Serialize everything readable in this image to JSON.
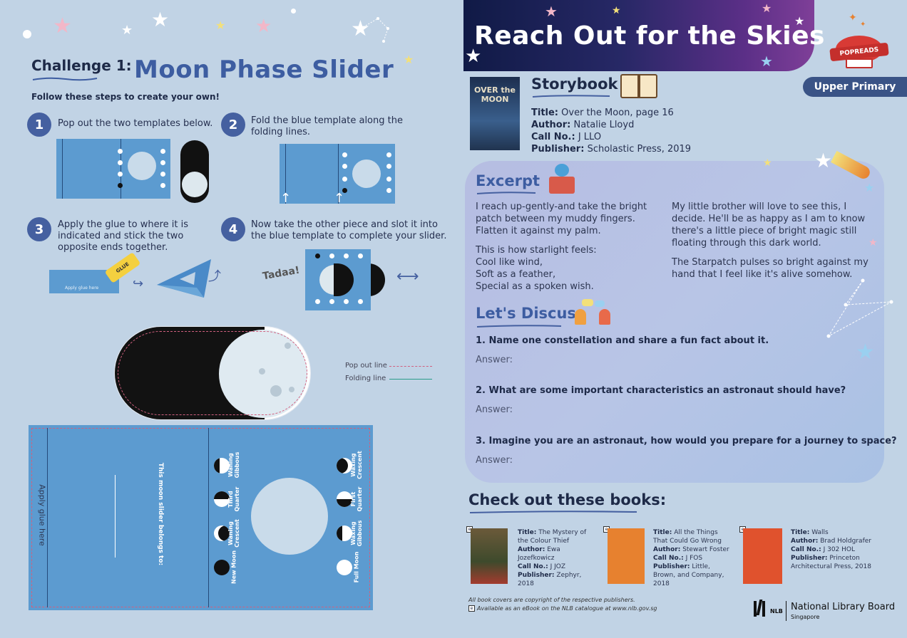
{
  "challenge": {
    "label": "Challenge 1:",
    "title": "Moon Phase Slider",
    "instructions": "Follow these steps to create your own!"
  },
  "steps": [
    {
      "num": "1",
      "text": "Pop out the two templates below."
    },
    {
      "num": "2",
      "text": "Fold the blue template along the folding lines."
    },
    {
      "num": "3",
      "text": "Apply the glue to where it is indicated and stick the two opposite ends together."
    },
    {
      "num": "4",
      "text": "Now take the other piece and slot it into the blue template to complete your slider."
    }
  ],
  "illustrations": {
    "glue_label": "GLUE",
    "apply_glue_small": "Apply glue here",
    "tadaa": "Tadaa!"
  },
  "legend": {
    "pop_out": "Pop out line",
    "folding": "Folding line"
  },
  "template": {
    "apply_glue": "Apply glue here",
    "belongs_to": "This moon slider belongs to:",
    "phases_left": [
      {
        "label": "Waning Gibbous"
      },
      {
        "label": "Third Quarter"
      },
      {
        "label": "Waning Crescent"
      },
      {
        "label": "New Moon"
      }
    ],
    "phases_right": [
      {
        "label": "Waxing Crescent"
      },
      {
        "label": "First Quarter"
      },
      {
        "label": "Waxing Gibbous"
      },
      {
        "label": "Full Moon"
      }
    ]
  },
  "header": {
    "title": "Reach Out for the Skies",
    "logo_text": "POPREADS",
    "level": "Upper Primary"
  },
  "storybook": {
    "heading": "Storybook",
    "cover_title": "OVER the MOON",
    "title_label": "Title:",
    "title": "Over the Moon, page 16",
    "author_label": "Author:",
    "author": "Natalie Lloyd",
    "call_label": "Call No.:",
    "call_no": "J LLO",
    "publisher_label": "Publisher:",
    "publisher": "Scholastic Press, 2019"
  },
  "excerpt": {
    "heading": "Excerpt",
    "left": [
      "I reach up-gently-and take the bright patch between my muddy fingers. Flatten it against my palm.",
      "This is how starlight feels:\nCool like wind,\nSoft as a feather,\nSpecial as a spoken wish."
    ],
    "right": [
      "My little brother will love to see this, I decide. He'll be as happy as I am to know there's a little piece of bright magic still floating through this dark world.",
      "The Starpatch pulses so bright against my hand that I feel like it's alive somehow."
    ]
  },
  "discuss": {
    "heading": "Let's Discuss",
    "answer_label": "Answer:",
    "questions": [
      "1. Name one constellation and share a fun fact about it.",
      "2. What are some important characteristics an astronaut should have?",
      "3. Imagine you are an astronaut, how would you prepare for a journey to space?"
    ]
  },
  "check_out": {
    "heading": "Check out these books:",
    "books": [
      {
        "title_label": "Title:",
        "title": "The Mystery of the Colour Thief",
        "author_label": "Author:",
        "author": "Ewa Jozefkowicz",
        "call_label": "Call No.:",
        "call_no": "J JOZ",
        "publisher_label": "Publisher:",
        "publisher": "Zephyr, 2018",
        "cover_color": "#6b5a3a"
      },
      {
        "title_label": "Title:",
        "title": "All the Things That Could Go Wrong",
        "author_label": "Author:",
        "author": "Stewart Foster",
        "call_label": "Call No.:",
        "call_no": "J FOS",
        "publisher_label": "Publisher:",
        "publisher": "Little, Brown, and Company, 2018",
        "cover_color": "#e7812f"
      },
      {
        "title_label": "Title:",
        "title": "Walls",
        "author_label": "Author:",
        "author": "Brad Holdgrafer",
        "call_label": "Call No.:",
        "call_no": "J 302 HOL",
        "publisher_label": "Publisher:",
        "publisher": "Princeton Architectural Press, 2018",
        "cover_color": "#e0522d"
      }
    ]
  },
  "footer": {
    "copyright": "All book covers are copyright of the respective publishers.",
    "ebook_note": "Available as an eBook on the NLB catalogue at www.nlb.gov.sg",
    "nlb_abbr": "NLB",
    "org": "National Library Board",
    "country": "Singapore"
  },
  "colors": {
    "background": "#c1d3e5",
    "accent": "#3d5da1",
    "template_blue": "#5c9bd0",
    "pop_out_line": "#d0607f",
    "folding_line": "#2a9c8a"
  }
}
